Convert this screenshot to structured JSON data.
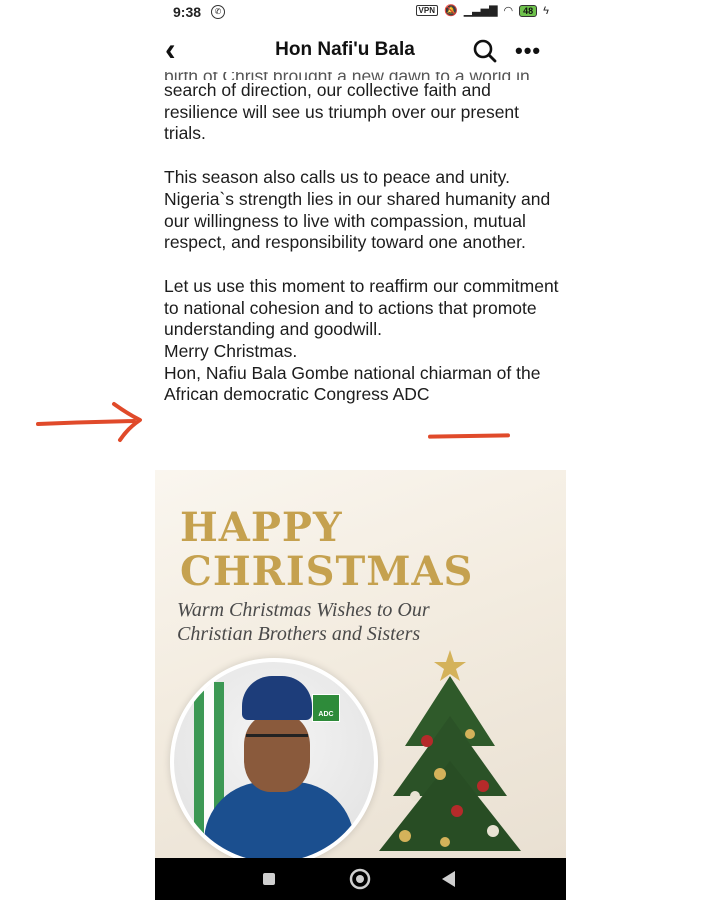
{
  "status_bar": {
    "time": "9:38",
    "vpn_label": "VPN",
    "battery_level": "48"
  },
  "header": {
    "title": "Hon Nafi'u Bala"
  },
  "post": {
    "cut_line": "birth of Christ brought a new dawn to a world in",
    "paragraph1": "search of direction, our collective faith and resilience will see us triumph over our present trials.",
    "paragraph2": "This season also calls us to peace and unity. Nigeria`s strength lies in our shared humanity and our willingness to live with compassion, mutual respect, and responsibility toward one another.",
    "paragraph3": "Let us use this moment to reaffirm our commitment to national cohesion and to actions that promote understanding and goodwill.",
    "line_merry": "Merry Christmas.",
    "line_sign": "Hon, Nafiu Bala Gombe national chiarman of the African democratic Congress ADC"
  },
  "card": {
    "title_line1": "HAPPY",
    "title_line2": "CHRISTMAS",
    "subtitle_line1": "Warm Christmas Wishes to Our",
    "subtitle_line2": "Christian Brothers and Sisters",
    "logo_text": "ADC"
  },
  "colors": {
    "annotation_red": "#e04a2a",
    "gold": "#c5a14f",
    "party_green": "#2e8b3a"
  },
  "icons": {
    "back": "chevron-left-icon",
    "search": "search-icon",
    "more": "more-options-icon",
    "nav_recent": "square-icon",
    "nav_home": "circle-icon",
    "nav_back": "triangle-back-icon"
  }
}
